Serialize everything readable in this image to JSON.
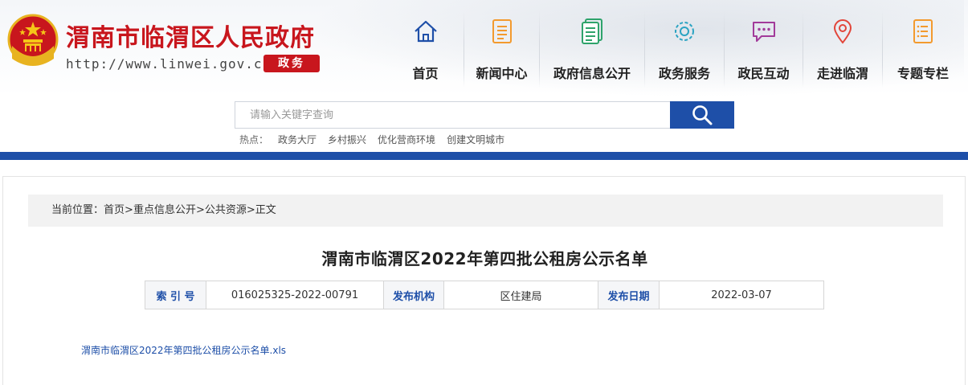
{
  "header": {
    "site_title": "渭南市临渭区人民政府",
    "site_url": "http://www.linwei.gov.cn",
    "badge": "政务",
    "colors": {
      "brand_red": "#c8161d",
      "brand_blue": "#1e4fa8",
      "icon_orange": "#f39a2e"
    }
  },
  "nav": {
    "items": [
      {
        "label": "首页",
        "icon": "home-icon"
      },
      {
        "label": "新闻中心",
        "icon": "news-document-icon"
      },
      {
        "label": "政府信息公开",
        "icon": "info-document-icon"
      },
      {
        "label": "政务服务",
        "icon": "gear-service-icon"
      },
      {
        "label": "政民互动",
        "icon": "chat-bubble-icon"
      },
      {
        "label": "走进临渭",
        "icon": "map-pin-icon"
      },
      {
        "label": "专题专栏",
        "icon": "list-document-icon"
      }
    ]
  },
  "search": {
    "placeholder": "请输入关键字查询",
    "button_icon": "search-icon"
  },
  "hot": {
    "label": "热点：",
    "links": [
      "政务大厅",
      "乡村振兴",
      "优化营商环境",
      "创建文明城市"
    ]
  },
  "breadcrumb": {
    "prefix": "当前位置：",
    "items": [
      "首页",
      "重点信息公开",
      "公共资源",
      "正文"
    ],
    "separator": ">"
  },
  "article": {
    "title": "渭南市临渭区2022年第四批公租房公示名单",
    "meta": {
      "index_label": "索 引 号",
      "index_value": "016025325-2022-00791",
      "org_label": "发布机构",
      "org_value": "区住建局",
      "date_label": "发布日期",
      "date_value": "2022-03-07"
    },
    "attachment": "渭南市临渭区2022年第四批公租房公示名单.xls"
  }
}
